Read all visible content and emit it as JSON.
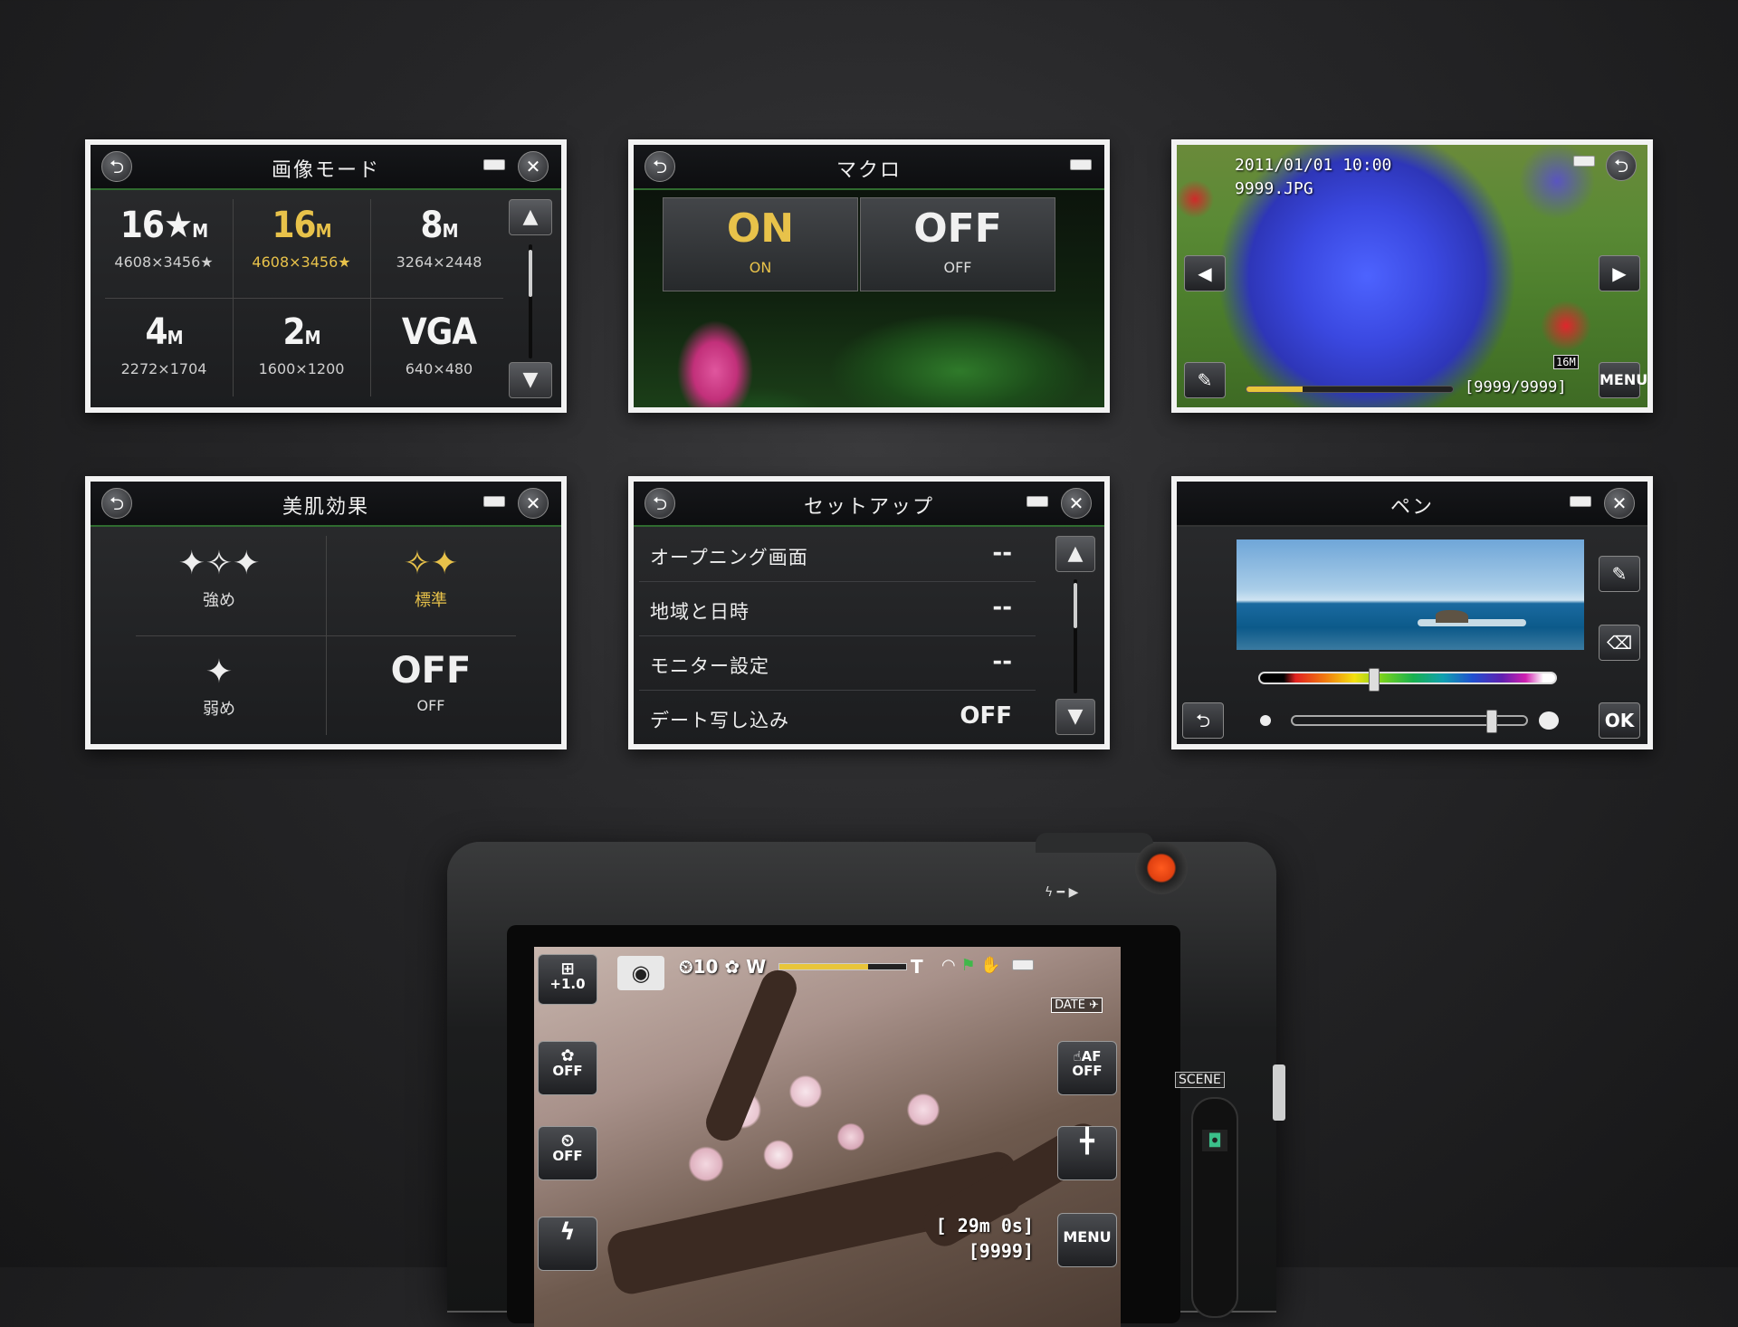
{
  "image_mode": {
    "title": "画像モード",
    "options": [
      {
        "big": "16★",
        "unit": "M",
        "size": "4608×3456★",
        "selected": false
      },
      {
        "big": "16",
        "unit": "M",
        "size": "4608×3456★",
        "selected": true
      },
      {
        "big": "8",
        "unit": "M",
        "size": "3264×2448",
        "selected": false
      },
      {
        "big": "4",
        "unit": "M",
        "size": "2272×1704",
        "selected": false
      },
      {
        "big": "2",
        "unit": "M",
        "size": "1600×1200",
        "selected": false
      },
      {
        "big": "VGA",
        "unit": "",
        "size": "640×480",
        "selected": false
      }
    ]
  },
  "macro": {
    "title": "マクロ",
    "on": {
      "big": "ON",
      "sub": "ON"
    },
    "off": {
      "big": "OFF",
      "sub": "OFF"
    }
  },
  "playback": {
    "datetime": "2011/01/01 10:00",
    "filename": "9999.JPG",
    "counter": "[9999/9999]",
    "menu_label": "MENU",
    "progress_fraction": 0.27,
    "size_badge": "16M"
  },
  "skin": {
    "title": "美肌効果",
    "strong": "強め",
    "standard": "標準",
    "weak": "弱め",
    "off_big": "OFF",
    "off_sub": "OFF"
  },
  "setup": {
    "title": "セットアップ",
    "rows": [
      {
        "label": "オープニング画面",
        "value": "--"
      },
      {
        "label": "地域と日時",
        "value": "--"
      },
      {
        "label": "モニター設定",
        "value": "--"
      },
      {
        "label": "デート写し込み",
        "value": "OFF"
      }
    ]
  },
  "pen": {
    "title": "ペン",
    "ok_label": "OK"
  },
  "camera": {
    "exposure": "+1.0",
    "macro_off": "OFF",
    "timer_off": "OFF",
    "timer_top": "10",
    "af_label": "AF",
    "af_off": "OFF",
    "date_label": "DATE",
    "remaining_time": "[ 29m 0s]",
    "remaining_shots": "[9999]",
    "menu_label": "MENU",
    "scene_label": "SCENE",
    "zoom_w": "W",
    "zoom_t": "T"
  }
}
